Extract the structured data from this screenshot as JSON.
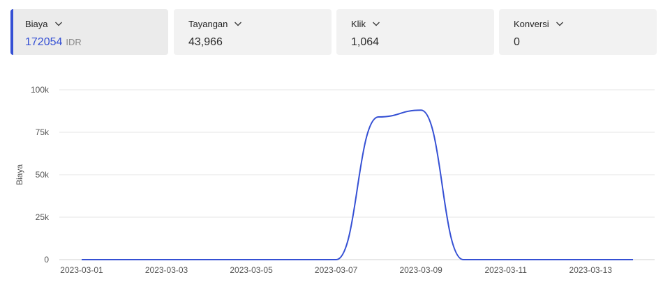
{
  "metrics": [
    {
      "label": "Biaya",
      "value": "172054",
      "unit": "IDR",
      "active": true
    },
    {
      "label": "Tayangan",
      "value": "43,966",
      "unit": "",
      "active": false
    },
    {
      "label": "Klik",
      "value": "1,064",
      "unit": "",
      "active": false
    },
    {
      "label": "Konversi",
      "value": "0",
      "unit": "",
      "active": false
    }
  ],
  "colors": {
    "accent": "#3550d4",
    "line": "#3550d4",
    "grid": "#e6e6e6",
    "card_bg": "#f2f2f2"
  },
  "icons": {
    "dropdown": "chevron-down-icon"
  },
  "chart_data": {
    "type": "line",
    "ylabel": "Biaya",
    "xlabel": "",
    "ylim": [
      0,
      100000
    ],
    "yticks": [
      0,
      25000,
      50000,
      75000,
      100000
    ],
    "ytick_labels": [
      "0",
      "25k",
      "50k",
      "75k",
      "100k"
    ],
    "x_tick_labels": [
      "2023-03-01",
      "2023-03-03",
      "2023-03-05",
      "2023-03-07",
      "2023-03-09",
      "2023-03-11",
      "2023-03-13"
    ],
    "x": [
      "2023-03-01",
      "2023-03-02",
      "2023-03-03",
      "2023-03-04",
      "2023-03-05",
      "2023-03-06",
      "2023-03-07",
      "2023-03-08",
      "2023-03-09",
      "2023-03-10",
      "2023-03-11",
      "2023-03-12",
      "2023-03-13",
      "2023-03-14"
    ],
    "series": [
      {
        "values": [
          0,
          0,
          0,
          0,
          0,
          0,
          0,
          84000,
          88000,
          0,
          0,
          0,
          0,
          0
        ]
      }
    ],
    "grid": true
  }
}
